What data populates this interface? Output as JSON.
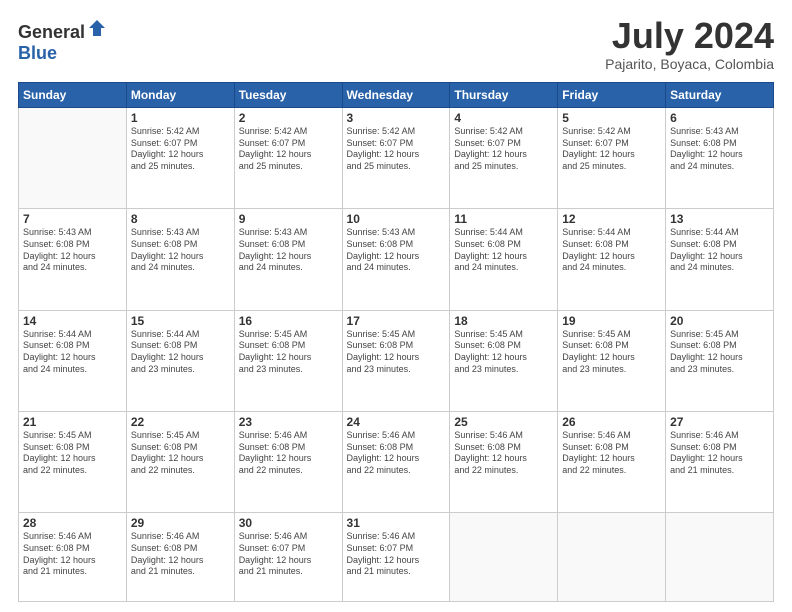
{
  "header": {
    "logo_general": "General",
    "logo_blue": "Blue",
    "month_year": "July 2024",
    "location": "Pajarito, Boyaca, Colombia"
  },
  "weekdays": [
    "Sunday",
    "Monday",
    "Tuesday",
    "Wednesday",
    "Thursday",
    "Friday",
    "Saturday"
  ],
  "weeks": [
    [
      {
        "day": "",
        "sunrise": "",
        "sunset": "",
        "daylight": ""
      },
      {
        "day": "1",
        "sunrise": "Sunrise: 5:42 AM",
        "sunset": "Sunset: 6:07 PM",
        "daylight": "Daylight: 12 hours and 25 minutes."
      },
      {
        "day": "2",
        "sunrise": "Sunrise: 5:42 AM",
        "sunset": "Sunset: 6:07 PM",
        "daylight": "Daylight: 12 hours and 25 minutes."
      },
      {
        "day": "3",
        "sunrise": "Sunrise: 5:42 AM",
        "sunset": "Sunset: 6:07 PM",
        "daylight": "Daylight: 12 hours and 25 minutes."
      },
      {
        "day": "4",
        "sunrise": "Sunrise: 5:42 AM",
        "sunset": "Sunset: 6:07 PM",
        "daylight": "Daylight: 12 hours and 25 minutes."
      },
      {
        "day": "5",
        "sunrise": "Sunrise: 5:42 AM",
        "sunset": "Sunset: 6:07 PM",
        "daylight": "Daylight: 12 hours and 25 minutes."
      },
      {
        "day": "6",
        "sunrise": "Sunrise: 5:43 AM",
        "sunset": "Sunset: 6:08 PM",
        "daylight": "Daylight: 12 hours and 24 minutes."
      }
    ],
    [
      {
        "day": "7",
        "sunrise": "Sunrise: 5:43 AM",
        "sunset": "Sunset: 6:08 PM",
        "daylight": "Daylight: 12 hours and 24 minutes."
      },
      {
        "day": "8",
        "sunrise": "Sunrise: 5:43 AM",
        "sunset": "Sunset: 6:08 PM",
        "daylight": "Daylight: 12 hours and 24 minutes."
      },
      {
        "day": "9",
        "sunrise": "Sunrise: 5:43 AM",
        "sunset": "Sunset: 6:08 PM",
        "daylight": "Daylight: 12 hours and 24 minutes."
      },
      {
        "day": "10",
        "sunrise": "Sunrise: 5:43 AM",
        "sunset": "Sunset: 6:08 PM",
        "daylight": "Daylight: 12 hours and 24 minutes."
      },
      {
        "day": "11",
        "sunrise": "Sunrise: 5:44 AM",
        "sunset": "Sunset: 6:08 PM",
        "daylight": "Daylight: 12 hours and 24 minutes."
      },
      {
        "day": "12",
        "sunrise": "Sunrise: 5:44 AM",
        "sunset": "Sunset: 6:08 PM",
        "daylight": "Daylight: 12 hours and 24 minutes."
      },
      {
        "day": "13",
        "sunrise": "Sunrise: 5:44 AM",
        "sunset": "Sunset: 6:08 PM",
        "daylight": "Daylight: 12 hours and 24 minutes."
      }
    ],
    [
      {
        "day": "14",
        "sunrise": "Sunrise: 5:44 AM",
        "sunset": "Sunset: 6:08 PM",
        "daylight": "Daylight: 12 hours and 24 minutes."
      },
      {
        "day": "15",
        "sunrise": "Sunrise: 5:44 AM",
        "sunset": "Sunset: 6:08 PM",
        "daylight": "Daylight: 12 hours and 23 minutes."
      },
      {
        "day": "16",
        "sunrise": "Sunrise: 5:45 AM",
        "sunset": "Sunset: 6:08 PM",
        "daylight": "Daylight: 12 hours and 23 minutes."
      },
      {
        "day": "17",
        "sunrise": "Sunrise: 5:45 AM",
        "sunset": "Sunset: 6:08 PM",
        "daylight": "Daylight: 12 hours and 23 minutes."
      },
      {
        "day": "18",
        "sunrise": "Sunrise: 5:45 AM",
        "sunset": "Sunset: 6:08 PM",
        "daylight": "Daylight: 12 hours and 23 minutes."
      },
      {
        "day": "19",
        "sunrise": "Sunrise: 5:45 AM",
        "sunset": "Sunset: 6:08 PM",
        "daylight": "Daylight: 12 hours and 23 minutes."
      },
      {
        "day": "20",
        "sunrise": "Sunrise: 5:45 AM",
        "sunset": "Sunset: 6:08 PM",
        "daylight": "Daylight: 12 hours and 23 minutes."
      }
    ],
    [
      {
        "day": "21",
        "sunrise": "Sunrise: 5:45 AM",
        "sunset": "Sunset: 6:08 PM",
        "daylight": "Daylight: 12 hours and 22 minutes."
      },
      {
        "day": "22",
        "sunrise": "Sunrise: 5:45 AM",
        "sunset": "Sunset: 6:08 PM",
        "daylight": "Daylight: 12 hours and 22 minutes."
      },
      {
        "day": "23",
        "sunrise": "Sunrise: 5:46 AM",
        "sunset": "Sunset: 6:08 PM",
        "daylight": "Daylight: 12 hours and 22 minutes."
      },
      {
        "day": "24",
        "sunrise": "Sunrise: 5:46 AM",
        "sunset": "Sunset: 6:08 PM",
        "daylight": "Daylight: 12 hours and 22 minutes."
      },
      {
        "day": "25",
        "sunrise": "Sunrise: 5:46 AM",
        "sunset": "Sunset: 6:08 PM",
        "daylight": "Daylight: 12 hours and 22 minutes."
      },
      {
        "day": "26",
        "sunrise": "Sunrise: 5:46 AM",
        "sunset": "Sunset: 6:08 PM",
        "daylight": "Daylight: 12 hours and 22 minutes."
      },
      {
        "day": "27",
        "sunrise": "Sunrise: 5:46 AM",
        "sunset": "Sunset: 6:08 PM",
        "daylight": "Daylight: 12 hours and 21 minutes."
      }
    ],
    [
      {
        "day": "28",
        "sunrise": "Sunrise: 5:46 AM",
        "sunset": "Sunset: 6:08 PM",
        "daylight": "Daylight: 12 hours and 21 minutes."
      },
      {
        "day": "29",
        "sunrise": "Sunrise: 5:46 AM",
        "sunset": "Sunset: 6:08 PM",
        "daylight": "Daylight: 12 hours and 21 minutes."
      },
      {
        "day": "30",
        "sunrise": "Sunrise: 5:46 AM",
        "sunset": "Sunset: 6:07 PM",
        "daylight": "Daylight: 12 hours and 21 minutes."
      },
      {
        "day": "31",
        "sunrise": "Sunrise: 5:46 AM",
        "sunset": "Sunset: 6:07 PM",
        "daylight": "Daylight: 12 hours and 21 minutes."
      },
      {
        "day": "",
        "sunrise": "",
        "sunset": "",
        "daylight": ""
      },
      {
        "day": "",
        "sunrise": "",
        "sunset": "",
        "daylight": ""
      },
      {
        "day": "",
        "sunrise": "",
        "sunset": "",
        "daylight": ""
      }
    ]
  ]
}
